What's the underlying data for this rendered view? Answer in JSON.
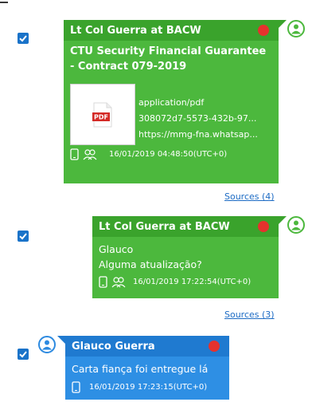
{
  "messages": [
    {
      "sender": "Lt Col Guerra at BACW",
      "subject": "CTU Security Financial Guarantee - Contract 079-2019",
      "attachment": {
        "mime": "application/pdf",
        "id": "308072d7-5573-432b-97...",
        "url": "https://mmg-fna.whatsap...",
        "icon": "pdf-file-icon"
      },
      "timestamp": "16/01/2019 04:48:50(UTC+0)",
      "sources": "Sources (4)",
      "checked": true
    },
    {
      "sender": "Lt Col Guerra at BACW",
      "body_line1": "Glauco",
      "body_line2": "Alguma atualização?",
      "timestamp": "16/01/2019 17:22:54(UTC+0)",
      "sources": "Sources (3)",
      "checked": true
    },
    {
      "sender": "Glauco Guerra",
      "body": "Carta fiança foi entregue lá",
      "timestamp": "16/01/2019 17:23:15(UTC+0)",
      "checked": true
    }
  ],
  "colors": {
    "incoming_bubble": "#4cb83d",
    "incoming_header": "#3aa32c",
    "outgoing_bubble": "#2e8fe4",
    "outgoing_header": "#1f7ad0",
    "status_dot": "#e5322d",
    "link": "#1c6bc4",
    "checkbox": "#1a73c9"
  }
}
